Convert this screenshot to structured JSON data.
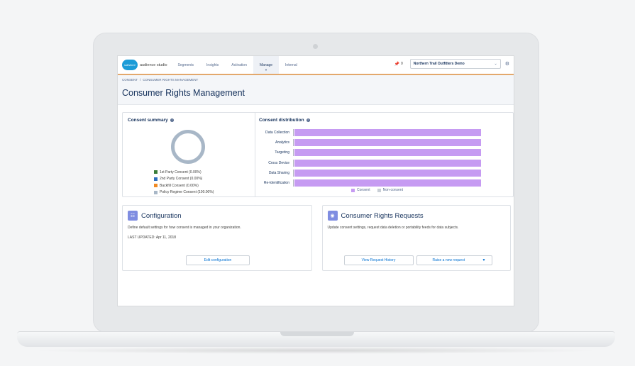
{
  "app": {
    "logo_text": "salesforce",
    "name": "audience studio"
  },
  "nav": {
    "items": [
      {
        "label": "Segments"
      },
      {
        "label": "Insights"
      },
      {
        "label": "Activation"
      },
      {
        "label": "Manage"
      },
      {
        "label": "Internal"
      }
    ],
    "active": "Manage",
    "pin_count": "0",
    "org_selector": "Northern Trail Outfitters Demo"
  },
  "breadcrumb": {
    "items": [
      "CONSENT",
      "CONSUMER RIGHTS MANAGEMENT"
    ],
    "separator": "/"
  },
  "page_title": "Consumer Rights Management",
  "consent_summary": {
    "title": "Consent summary",
    "donut_color": "#a8b7c7",
    "legend": [
      {
        "label": "1st Party Consent (0.00%)",
        "color": "#3a7d3a"
      },
      {
        "label": "2nd Party Consent (0.00%)",
        "color": "#2f6fbf"
      },
      {
        "label": "Backfill Consent (0.00%)",
        "color": "#f08a24"
      },
      {
        "label": "Policy Regime Consent (100.00%)",
        "color": "#a8b7c7"
      }
    ]
  },
  "consent_distribution": {
    "title": "Consent distribution",
    "legend": [
      {
        "label": "Consent",
        "color": "#c69bf2"
      },
      {
        "label": "Non-consent",
        "color": "#c9cfd6"
      }
    ]
  },
  "chart_data": {
    "type": "bar",
    "orientation": "horizontal",
    "stacked": true,
    "categories": [
      "Data Collection",
      "Analytics",
      "Targeting",
      "Cross Device",
      "Data Sharing",
      "Re-Identification"
    ],
    "series": [
      {
        "name": "Consent",
        "values": [
          100,
          100,
          100,
          100,
          100,
          100
        ]
      },
      {
        "name": "Non-consent",
        "values": [
          0,
          0,
          0,
          0,
          0,
          0
        ]
      }
    ],
    "xlim": [
      0,
      100
    ],
    "legend_position": "bottom"
  },
  "configuration": {
    "title": "Configuration",
    "description": "Define default settings for how consent is managed in your organization.",
    "last_updated": "LAST UPDATED: Apr 11, 2018",
    "button": "Edit configuration"
  },
  "consumer_rights": {
    "title": "Consumer Rights Requests",
    "description": "Update consent settings, request data deletion or portability feeds for data subjects.",
    "history_button": "View Request History",
    "raise_button": "Raise a new request"
  }
}
